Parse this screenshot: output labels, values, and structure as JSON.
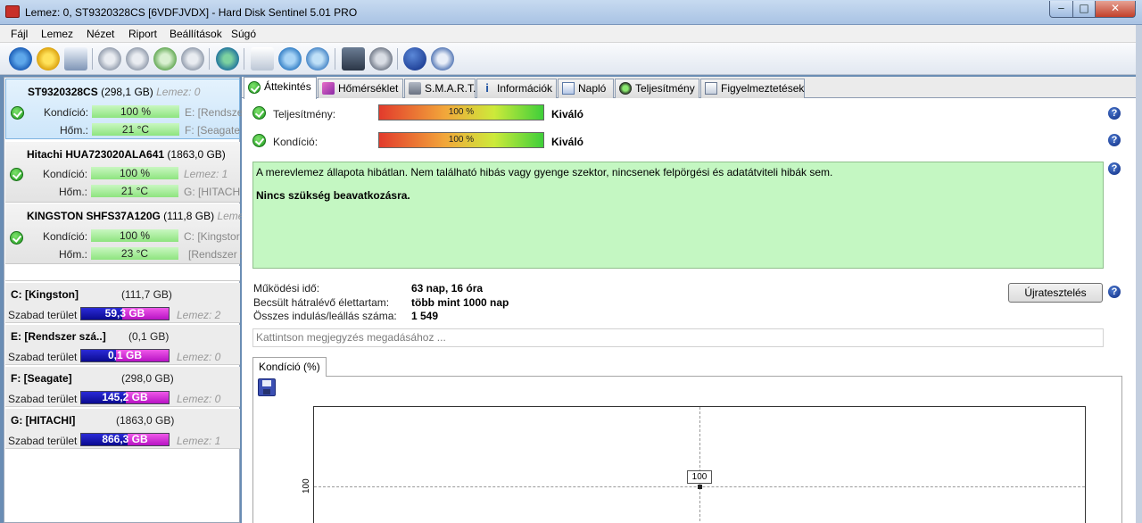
{
  "window": {
    "title": "Lemez: 0, ST9320328CS [6VDFJVDX]  -  Hard Disk Sentinel 5.01 PRO"
  },
  "menu": [
    "Fájl",
    "Lemez",
    "Nézet",
    "Riport",
    "Beállítások",
    "Súgó"
  ],
  "disks": [
    {
      "name": "ST9320328CS",
      "size": "(298,1 GB)",
      "lemez": "Lemez: 0",
      "kondicio_label": "Kondíció:",
      "kondicio": "100 %",
      "kondicio_pct": 100,
      "hom_label": "Hőm.:",
      "hom": "21 °C",
      "vol1": "E: [Rendsze",
      "vol2": "F: [Seagate"
    },
    {
      "name": "Hitachi HUA723020ALA641",
      "size": "(1863,0 GB)",
      "lemez": "",
      "kondicio_label": "Kondíció:",
      "kondicio": "100 %",
      "kondicio_pct": 100,
      "hom_label": "Hőm.:",
      "hom": "21 °C",
      "vol1": "Lemez: 1",
      "vol2": "G: [HITACH"
    },
    {
      "name": "KINGSTON SHFS37A120G",
      "size": "(111,8 GB)",
      "lemez": "Lemez",
      "kondicio_label": "Kondíció:",
      "kondicio": "100 %",
      "kondicio_pct": 100,
      "hom_label": "Hőm.:",
      "hom": "23 °C",
      "vol1": "C: [Kingstor",
      "vol2": "[Rendszer s"
    }
  ],
  "volumes": [
    {
      "name": "C: [Kingston]",
      "size": "(111,7 GB)",
      "free_label": "Szabad terület",
      "free": "59,3 GB",
      "used_frac": 0.47,
      "lemez": "Lemez: 2"
    },
    {
      "name": "E: [Rendszer szá..]",
      "size": "(0,1 GB)",
      "free_label": "Szabad terület",
      "free": "0,1 GB",
      "used_frac": 0.4,
      "lemez": "Lemez: 0"
    },
    {
      "name": "F: [Seagate]",
      "size": "(298,0 GB)",
      "free_label": "Szabad terület",
      "free": "145,2 GB",
      "used_frac": 0.51,
      "lemez": "Lemez: 0"
    },
    {
      "name": "G: [HITACHI]",
      "size": "(1863,0 GB)",
      "free_label": "Szabad terület",
      "free": "866,3 GB",
      "used_frac": 0.53,
      "lemez": "Lemez: 1"
    }
  ],
  "tabs": [
    "Áttekintés",
    "Hőmérséklet",
    "S.M.A.R.T.",
    "Információk",
    "Napló",
    "Teljesítmény",
    "Figyelmeztetések"
  ],
  "overview": {
    "performance_label": "Teljesítmény:",
    "performance_value": "100 %",
    "performance_pct": 100,
    "performance_rating": "Kiváló",
    "health_label": "Kondíció:",
    "health_value": "100 %",
    "health_pct": 100,
    "health_rating": "Kiváló",
    "message": "A merevlemez állapota hibátlan. Nem található hibás vagy gyenge szektor, nincsenek felpörgési és adatátviteli hibák sem.",
    "recommendation": "Nincs szükség beavatkozásra.",
    "uptime_label": "Működési idő:",
    "uptime": "63 nap, 16 óra",
    "lifetime_label": "Becsült hátralévő élettartam:",
    "lifetime": "több mint 1000 nap",
    "starts_label": "Összes indulás/leállás száma:",
    "starts": "1 549",
    "retest_button": "Újratesztelés",
    "note_placeholder": "Kattintson megjegyzés megadásához ..."
  },
  "chart_tab": "Kondíció  (%)",
  "chart_data": {
    "type": "line",
    "series": [
      {
        "values": [
          100
        ]
      }
    ],
    "data_labels": [
      "100"
    ],
    "y_ticks": [
      "100"
    ]
  },
  "colors": {
    "ok_green": "#c4f7c2",
    "bar_green": "#8ee47f",
    "vol_used": "#0b0b90",
    "vol_free": "#b813c4"
  }
}
